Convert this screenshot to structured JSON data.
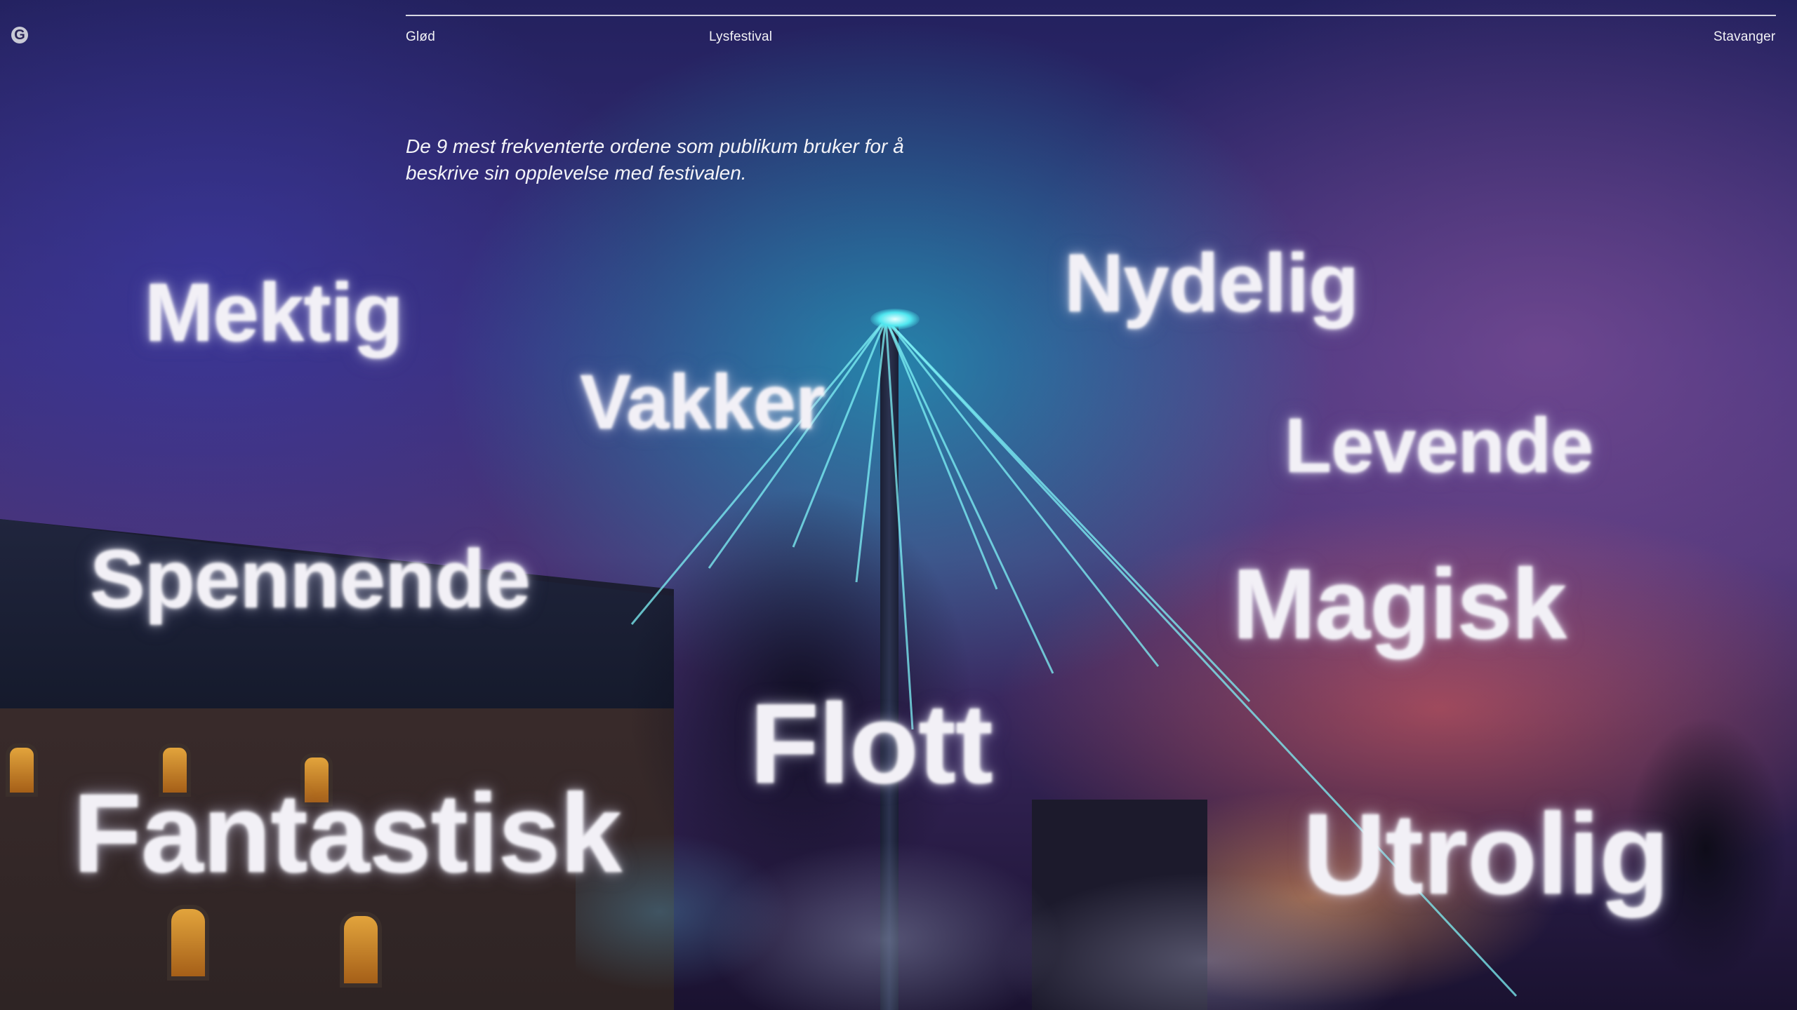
{
  "brand": {
    "logo_icon": "spiral-g-logo"
  },
  "nav": {
    "left": "Glød",
    "center": "Lysfestival",
    "right": "Stavanger"
  },
  "subtitle": "De 9 mest frekventerte ordene som publikum bruker for å beskrive sin opplevelse med festivalen.",
  "words": [
    "Mektig",
    "Vakker",
    "Nydelig",
    "Levende",
    "Spennende",
    "Magisk",
    "Flott",
    "Fantastisk",
    "Utrolig"
  ],
  "colors": {
    "word_glow": "#f2f0f6",
    "laser": "#4fe6ef",
    "sky_dark": "#23215e"
  }
}
